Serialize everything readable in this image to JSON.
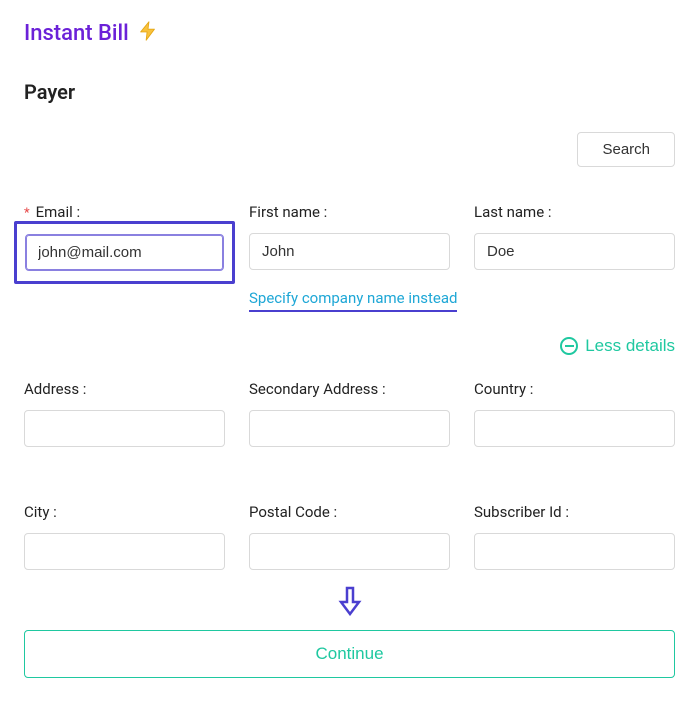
{
  "header": {
    "title": "Instant Bill"
  },
  "section": {
    "title": "Payer"
  },
  "search": {
    "label": "Search"
  },
  "fields": {
    "email": {
      "label": "Email :",
      "value": "john@mail.com"
    },
    "first_name": {
      "label": "First name :",
      "value": "John"
    },
    "last_name": {
      "label": "Last name :",
      "value": "Doe"
    },
    "address": {
      "label": "Address :",
      "value": ""
    },
    "secondary_address": {
      "label": "Secondary Address :",
      "value": ""
    },
    "country": {
      "label": "Country :",
      "value": ""
    },
    "city": {
      "label": "City :",
      "value": ""
    },
    "postal_code": {
      "label": "Postal Code :",
      "value": ""
    },
    "subscriber_id": {
      "label": "Subscriber Id :",
      "value": ""
    }
  },
  "links": {
    "company": "Specify company name instead",
    "less_details": "Less details"
  },
  "actions": {
    "continue": "Continue"
  }
}
